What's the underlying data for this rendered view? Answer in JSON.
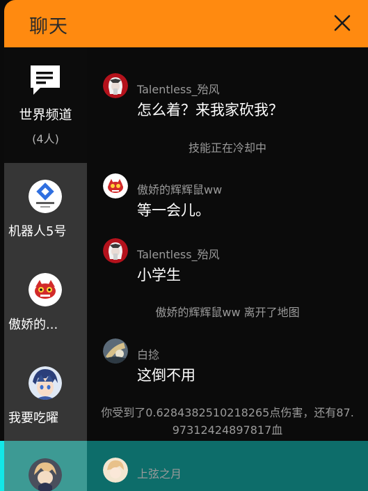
{
  "header": {
    "title": "聊天",
    "close_icon": "close-icon"
  },
  "sidebar": {
    "world": {
      "icon": "chat-bubble-icon",
      "label": "世界频道",
      "count": "(4人)"
    },
    "users": [
      {
        "name": "机器人5号",
        "avatar": "robot-avatar"
      },
      {
        "name": "傲娇的...",
        "avatar": "red-monster-avatar"
      },
      {
        "name": "我要吃曜",
        "avatar": "anime-avatar"
      },
      {
        "name": "",
        "avatar": "anime-avatar"
      }
    ]
  },
  "messages": [
    {
      "type": "user",
      "name": "Talentless_殆风",
      "text": "怎么着？来我家砍我？"
    },
    {
      "type": "system",
      "text": "技能正在冷却中"
    },
    {
      "type": "user",
      "name": "傲娇的辉辉鼠ww",
      "text": "等一会儿。"
    },
    {
      "type": "user",
      "name": "Talentless_殆风",
      "text": "小学生"
    },
    {
      "type": "system",
      "text": "傲娇的辉辉鼠ww 离开了地图"
    },
    {
      "type": "user",
      "name": "白捻",
      "text": "这倒不用"
    },
    {
      "type": "system",
      "text": "你受到了0.6284382510218265点伤害，还有87.97312424897817血"
    },
    {
      "type": "user",
      "name": "上弦之月",
      "text": ""
    }
  ],
  "colors": {
    "header": "#ff8a10",
    "sidebar_active": "#363636",
    "teal_highlight": "#0d6d6a",
    "cyan_edge": "#12e8e8"
  }
}
